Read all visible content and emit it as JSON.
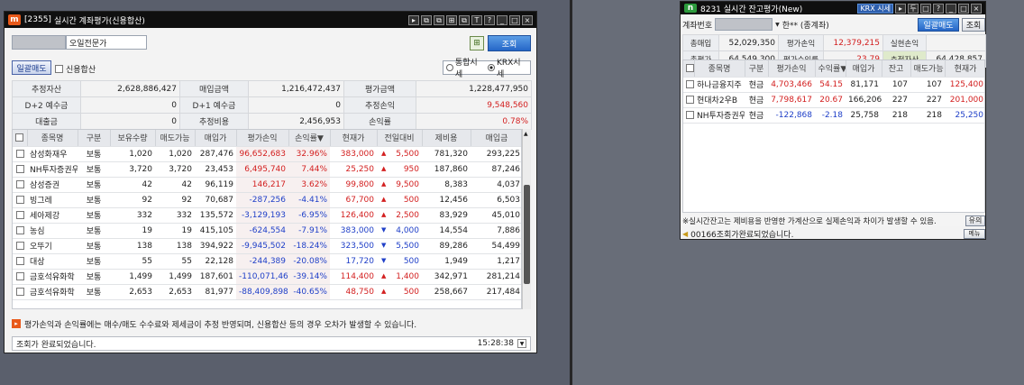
{
  "left_window": {
    "title_code": "[2355]",
    "title": "실시간 계좌평가(신용합산)",
    "logo": "m",
    "title_buttons": [
      "▸",
      "⧉",
      "⧉",
      "⊞",
      "⧉",
      "T",
      "?",
      "_",
      "□",
      "×"
    ],
    "account_name": "오일전문가",
    "search_button": "조회",
    "sell_all_button": "일괄매도",
    "credit_sum_label": "신용합산",
    "radio_integrated": "통합시세",
    "radio_krx": "KRX시세",
    "summary": {
      "row1": [
        "추정자산",
        "2,628,886,427",
        "매입금액",
        "1,216,472,437",
        "평가금액",
        "1,228,477,950"
      ],
      "row2": [
        "D+2 예수금",
        "0",
        "D+1 예수금",
        "0",
        "추정손익",
        "9,548,560"
      ],
      "row3": [
        "대출금",
        "0",
        "추정비용",
        "2,456,953",
        "손익률",
        "0.78%"
      ]
    },
    "columns": [
      "종목명",
      "구분",
      "보유수량",
      "매도가능",
      "매입가",
      "평가손익",
      "손익률▼",
      "현재가",
      "전일대비",
      "제비용",
      "매입금"
    ],
    "rows": [
      {
        "name": "삼성화재우",
        "type": "보통",
        "qty": "1,020",
        "avail": "1,020",
        "buy": "287,476",
        "pl": "96,652,683",
        "rate": "32.96%",
        "price": "383,000",
        "chg": "5,500",
        "dir": "up",
        "fee": "781,320",
        "amt": "293,225"
      },
      {
        "name": "NH투자증권우",
        "type": "보통",
        "qty": "3,720",
        "avail": "3,720",
        "buy": "23,453",
        "pl": "6,495,740",
        "rate": "7.44%",
        "price": "25,250",
        "chg": "950",
        "dir": "up",
        "fee": "187,860",
        "amt": "87,246"
      },
      {
        "name": "삼성증권",
        "type": "보통",
        "qty": "42",
        "avail": "42",
        "buy": "96,119",
        "pl": "146,217",
        "rate": "3.62%",
        "price": "99,800",
        "chg": "9,500",
        "dir": "up",
        "fee": "8,383",
        "amt": "4,037"
      },
      {
        "name": "빙그레",
        "type": "보통",
        "qty": "92",
        "avail": "92",
        "buy": "70,687",
        "pl": "-287,256",
        "rate": "-4.41%",
        "price": "67,700",
        "chg": "500",
        "dir": "up",
        "fee": "12,456",
        "amt": "6,503"
      },
      {
        "name": "세아제강",
        "type": "보통",
        "qty": "332",
        "avail": "332",
        "buy": "135,572",
        "pl": "-3,129,193",
        "rate": "-6.95%",
        "price": "126,400",
        "chg": "2,500",
        "dir": "up",
        "fee": "83,929",
        "amt": "45,010"
      },
      {
        "name": "농심",
        "type": "보통",
        "qty": "19",
        "avail": "19",
        "buy": "415,105",
        "pl": "-624,554",
        "rate": "-7.91%",
        "price": "383,000",
        "chg": "4,000",
        "dir": "dn",
        "fee": "14,554",
        "amt": "7,886"
      },
      {
        "name": "오뚜기",
        "type": "보통",
        "qty": "138",
        "avail": "138",
        "buy": "394,922",
        "pl": "-9,945,502",
        "rate": "-18.24%",
        "price": "323,500",
        "chg": "5,500",
        "dir": "dn",
        "fee": "89,286",
        "amt": "54,499"
      },
      {
        "name": "대상",
        "type": "보통",
        "qty": "55",
        "avail": "55",
        "buy": "22,128",
        "pl": "-244,389",
        "rate": "-20.08%",
        "price": "17,720",
        "chg": "500",
        "dir": "dn",
        "fee": "1,949",
        "amt": "1,217"
      },
      {
        "name": "금호석유화학",
        "type": "보통",
        "qty": "1,499",
        "avail": "1,499",
        "buy": "187,601",
        "pl": "-110,071,465",
        "rate": "-39.14%",
        "price": "114,400",
        "chg": "1,400",
        "dir": "up",
        "fee": "342,971",
        "amt": "281,214"
      },
      {
        "name": "금호석유화학",
        "type": "보통",
        "qty": "2,653",
        "avail": "2,653",
        "buy": "81,977",
        "pl": "-88,409,898",
        "rate": "-40.65%",
        "price": "48,750",
        "chg": "500",
        "dir": "up",
        "fee": "258,667",
        "amt": "217,484"
      }
    ],
    "notice": "평가손익과 손익률에는 매수/매도 수수료와 제세금이 추정 반영되며, 신용합산 등의 경우 오차가 발생할 수 있습니다.",
    "status": "조회가 완료되었습니다.",
    "time": "15:28:38"
  },
  "right_window": {
    "logo": "n",
    "title": "8231 실시간 잔고평가(New)",
    "krx_label": "KRX 시세",
    "title_buttons": [
      "▸",
      "두",
      "□",
      "?",
      "_",
      "□",
      "×"
    ],
    "account_label": "계좌번호",
    "account_suffix": "한** (종계좌)",
    "sell_all_button": "일괄매도",
    "search_button": "조회",
    "summary": {
      "row1": [
        "총매입",
        "52,029,350",
        "평가손익",
        "12,379,215",
        "실현손익",
        ""
      ],
      "row2": [
        "총평가",
        "64,549,300",
        "평가수익률",
        "23.79",
        "추정자산",
        "64,428,857"
      ]
    },
    "columns": [
      "종목명",
      "구분",
      "평가손익",
      "수익률▼",
      "매입가",
      "잔고",
      "매도가능",
      "현재가"
    ],
    "rows": [
      {
        "name": "하나금융지주",
        "type": "현금",
        "pl": "4,703,466",
        "rate": "54.15",
        "buy": "81,171",
        "bal": "107",
        "avail": "107",
        "price": "125,400",
        "color": "red"
      },
      {
        "name": "현대차2우B",
        "type": "현금",
        "pl": "7,798,617",
        "rate": "20.67",
        "buy": "166,206",
        "bal": "227",
        "avail": "227",
        "price": "201,000",
        "color": "red"
      },
      {
        "name": "NH투자증권우",
        "type": "현금",
        "pl": "-122,868",
        "rate": "-2.18",
        "buy": "25,758",
        "bal": "218",
        "avail": "218",
        "price": "25,250",
        "color": "blue"
      }
    ],
    "notice": "※실시간잔고는 제비용을 반영한 가계산으로 실제손익과 차이가 발생할 수 있음.",
    "notice_button": "유의",
    "status": "00166조회가완료되었습니다.",
    "menu_button": "메뉴"
  },
  "colors": {
    "profit": "#d32020",
    "loss": "#2040c8",
    "title_bg": "#0f0f0f",
    "accent_blue": "#2566c7"
  }
}
